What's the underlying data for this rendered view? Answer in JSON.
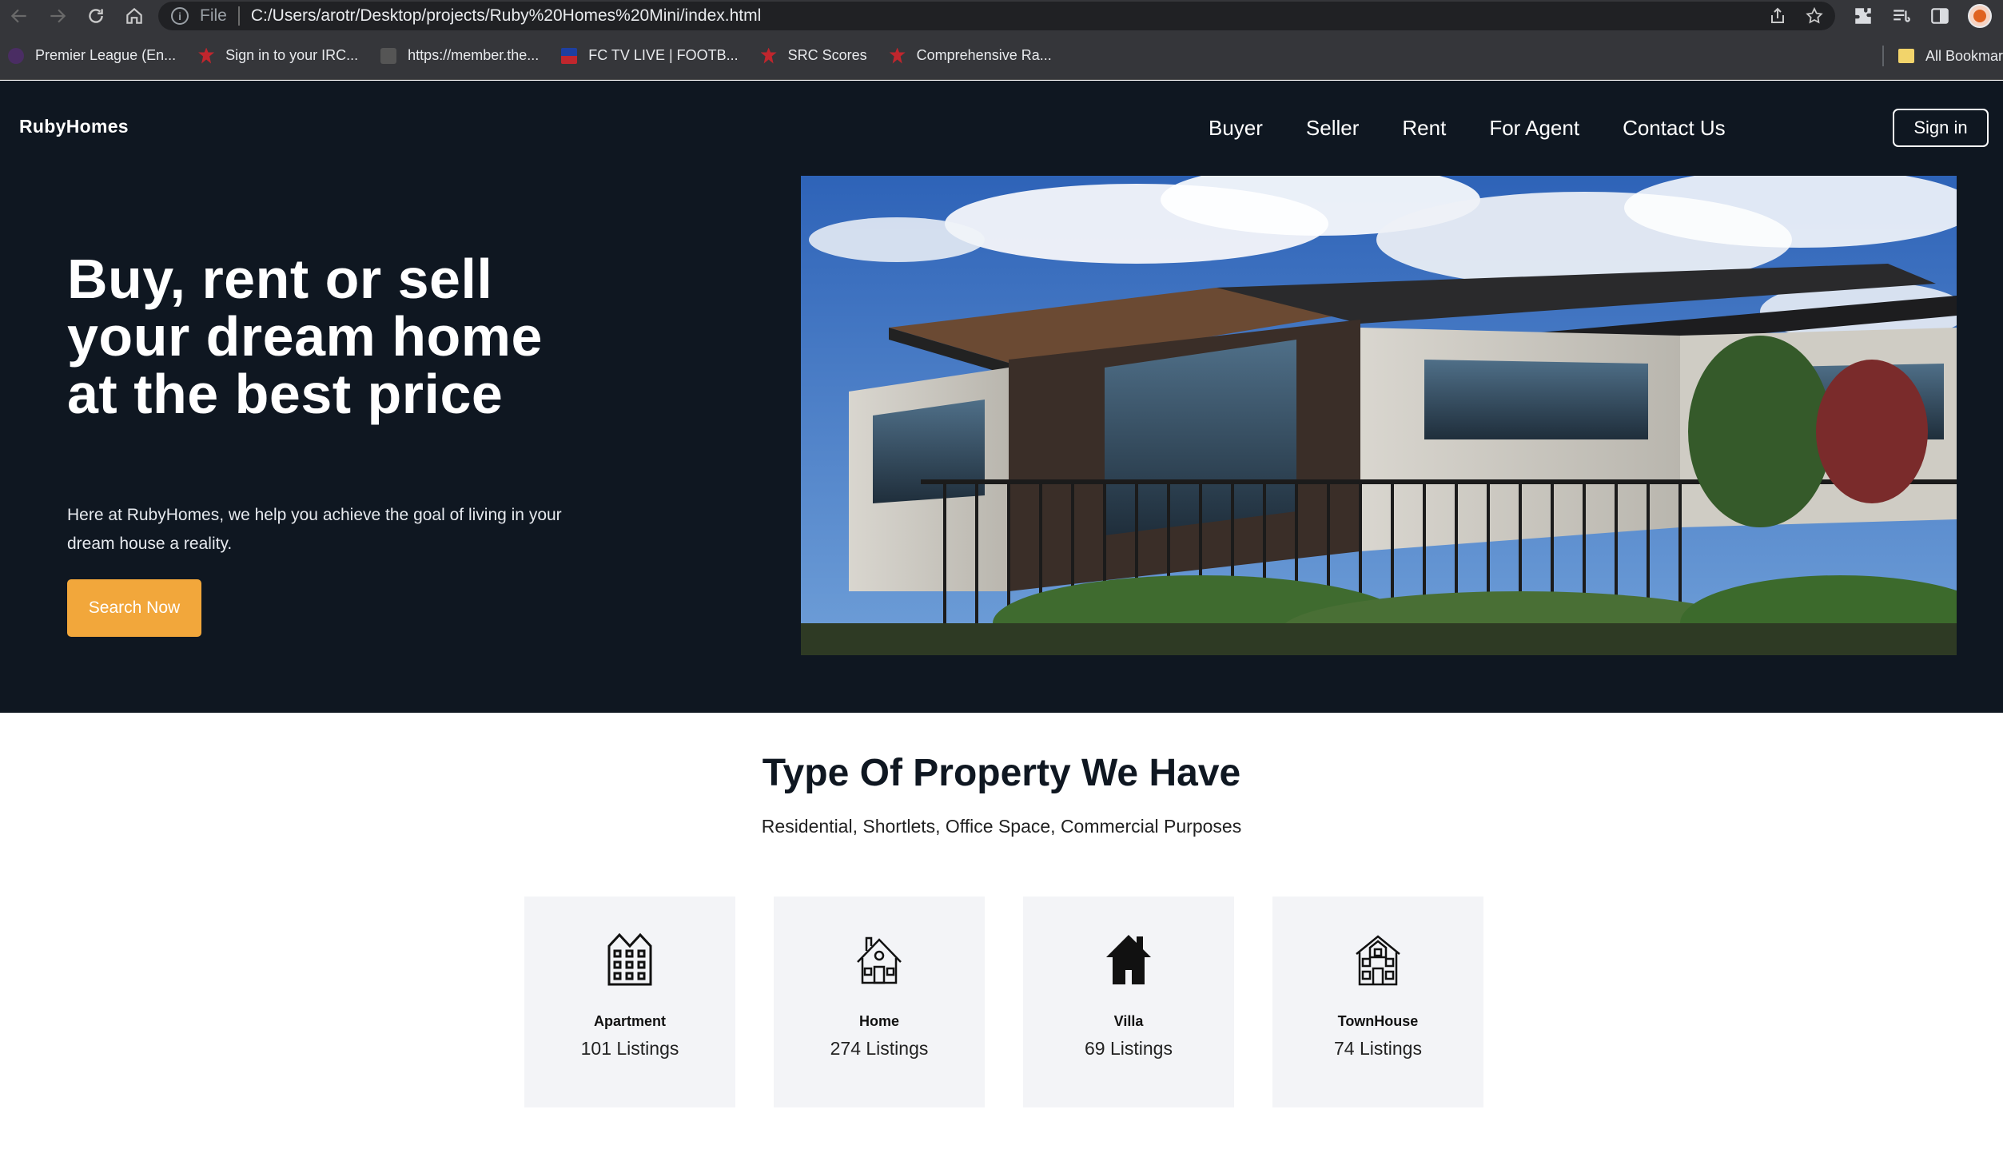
{
  "browser": {
    "address_file": "File",
    "url": "C:/Users/arotr/Desktop/projects/Ruby%20Homes%20Mini/index.html",
    "bookmarks": [
      {
        "label": "Premier League (En...",
        "icon": "purple-lion-icon"
      },
      {
        "label": "Sign in to your IRC...",
        "icon": "maple-leaf-icon"
      },
      {
        "label": "https://member.the...",
        "icon": "page-icon"
      },
      {
        "label": "FC TV LIVE | FOOTB...",
        "icon": "flag-icon"
      },
      {
        "label": "SRC Scores",
        "icon": "maple-leaf-icon"
      },
      {
        "label": "Comprehensive Ra...",
        "icon": "maple-leaf-icon"
      }
    ],
    "all_bookmarks": "All Bookmar"
  },
  "site": {
    "logo": "RubyHomes",
    "nav": [
      "Buyer",
      "Seller",
      "Rent",
      "For Agent",
      "Contact Us"
    ],
    "signin": "Sign in",
    "hero": {
      "title": "Buy, rent or sell your dream home at the best price",
      "text": "Here at RubyHomes, we help you achieve the goal of living in your dream house a reality.",
      "button": "Search Now"
    },
    "section": {
      "title": "Type Of Property We Have",
      "subtitle": "Residential, Shortlets, Office Space, Commercial Purposes"
    },
    "cards": [
      {
        "name": "Apartment",
        "count": "101 Listings",
        "icon": "apartment-icon"
      },
      {
        "name": "Home",
        "count": "274 Listings",
        "icon": "home-icon"
      },
      {
        "name": "Villa",
        "count": "69 Listings",
        "icon": "villa-icon"
      },
      {
        "name": "TownHouse",
        "count": "74 Listings",
        "icon": "townhouse-icon"
      }
    ]
  },
  "colors": {
    "dark_bg": "#0f1721",
    "accent": "#f2a73b",
    "card_bg": "#f3f4f7"
  }
}
